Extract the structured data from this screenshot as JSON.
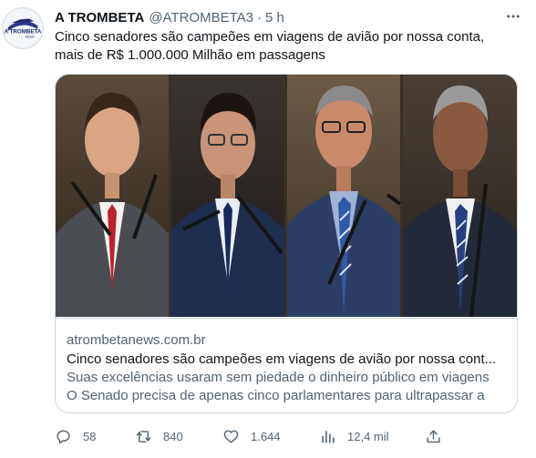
{
  "tweet": {
    "display_name": "A TROMBETA",
    "handle": "@ATROMBETA3",
    "separator": "·",
    "time": "5 h",
    "text_line1": "Cinco senadores são campeões em viagens de avião por nossa conta,",
    "text_line2": "mais de R$ 1.000.000 Milhão em passagens"
  },
  "avatar": {
    "logo_text": "A TROMBETA",
    "logo_sub": "NEWS"
  },
  "card": {
    "domain": "atrombetanews.com.br",
    "title": "Cinco senadores são campeões em viagens de avião por nossa cont...",
    "desc_line1": "Suas excelências usaram sem piedade o dinheiro público em viagens",
    "desc_line2": "O Senado precisa de apenas cinco parlamentares para ultrapassar a"
  },
  "actions": {
    "replies": "58",
    "retweets": "840",
    "likes": "1.644",
    "views": "12,4 mil"
  },
  "icons": {
    "avatar": "trombeta-logo",
    "more": "more-icon",
    "reply": "reply-icon",
    "retweet": "retweet-icon",
    "like": "heart-icon",
    "views": "views-icon",
    "share": "share-icon"
  },
  "colors": {
    "text": "#0f1419",
    "secondary": "#536471",
    "border": "#cfd9de"
  }
}
